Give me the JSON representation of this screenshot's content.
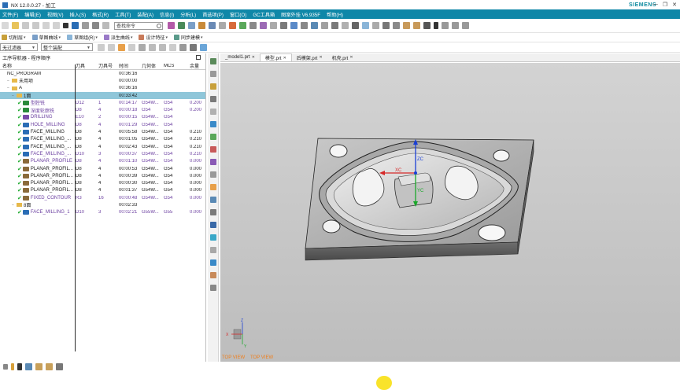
{
  "window": {
    "title": "NX 12.0.0.27 - 加工",
    "brand": "SIEMENS",
    "controls": [
      "—",
      "❐",
      "✕"
    ]
  },
  "menu": [
    "文件(F)",
    "编辑(E)",
    "视图(V)",
    "插入(S)",
    "格式(R)",
    "工具(T)",
    "装配(A)",
    "信息(I)",
    "分析(L)",
    "首选项(P)",
    "窗口(O)",
    "GC工具箱",
    "图案外挂 V6.935F",
    "帮助(H)"
  ],
  "toolbar": {
    "search_placeholder": "查找命令"
  },
  "toolbar2": {
    "items": [
      "切削层",
      "草图曲线",
      "草图组(R)",
      "派生曲线",
      "设计特征",
      "同步建模"
    ]
  },
  "filters": {
    "selection_filter": "无过滤器",
    "scope": "整个装配"
  },
  "navigator": {
    "title": "工序导航器 - 程序顺序",
    "columns": [
      "名称",
      "刀具",
      "刀具号",
      "时间",
      "几何体",
      "MCS",
      "余量"
    ],
    "tree": [
      {
        "name": "NC_PROGRAM",
        "time": "00:36:16",
        "level": 0
      },
      {
        "name": "未用项",
        "time": "00:00:00",
        "level": 1
      },
      {
        "name": "A",
        "time": "00:36:16",
        "level": 1
      },
      {
        "name": "1面",
        "time": "00:33:42",
        "level": 2,
        "selected": true
      }
    ],
    "operations": [
      {
        "name": "型腔铣",
        "tool": "D12",
        "num": "1",
        "time": "00:14:17",
        "geom": "G54W...",
        "mcs": "G54",
        "stock": "0.200",
        "purple": true,
        "icon": "#2a8a3a"
      },
      {
        "name": "深度轮廓铣",
        "tool": "D8",
        "num": "4",
        "time": "00:00:18",
        "geom": "G54",
        "mcs": "G54",
        "stock": "0.200",
        "purple": true,
        "icon": "#2a8a3a"
      },
      {
        "name": "DRILLING",
        "tool": "E10",
        "num": "2",
        "time": "00:00:15",
        "geom": "G54W...",
        "mcs": "G54",
        "stock": "",
        "purple": true,
        "icon": "#7a4aa8"
      },
      {
        "name": "HOLE_MILLING",
        "tool": "D8",
        "num": "4",
        "time": "00:01:29",
        "geom": "G54W...",
        "mcs": "G54",
        "stock": "",
        "purple": true,
        "icon": "#2a6db5"
      },
      {
        "name": "FACE_MILLING",
        "tool": "D8",
        "num": "4",
        "time": "00:05:58",
        "geom": "G54W...",
        "mcs": "G54",
        "stock": "0.210",
        "purple": false,
        "icon": "#2a6db5"
      },
      {
        "name": "FACE_MILLING_...",
        "tool": "D8",
        "num": "4",
        "time": "00:01:05",
        "geom": "G54W...",
        "mcs": "G54",
        "stock": "0.210",
        "purple": false,
        "icon": "#2a6db5"
      },
      {
        "name": "FACE_MILLING_...",
        "tool": "D8",
        "num": "4",
        "time": "00:02:43",
        "geom": "G54W...",
        "mcs": "G54",
        "stock": "0.210",
        "purple": false,
        "icon": "#2a6db5"
      },
      {
        "name": "FACE_MILLING_...",
        "tool": "D10",
        "num": "3",
        "time": "00:00:37",
        "geom": "G54W...",
        "mcs": "G54",
        "stock": "0.210",
        "purple": true,
        "icon": "#2a6db5"
      },
      {
        "name": "PLANAR_PROFILE",
        "tool": "D8",
        "num": "4",
        "time": "00:01:10",
        "geom": "G54W...",
        "mcs": "G54",
        "stock": "0.000",
        "purple": true,
        "icon": "#8a6a3a"
      },
      {
        "name": "PLANAR_PROFIL...",
        "tool": "D8",
        "num": "4",
        "time": "00:00:53",
        "geom": "G54W...",
        "mcs": "G54",
        "stock": "0.000",
        "purple": false,
        "icon": "#8a6a3a"
      },
      {
        "name": "PLANAR_PROFIL...",
        "tool": "D8",
        "num": "4",
        "time": "00:00:39",
        "geom": "G54W...",
        "mcs": "G54",
        "stock": "0.000",
        "purple": false,
        "icon": "#8a6a3a"
      },
      {
        "name": "PLANAR_PROFIL...",
        "tool": "D8",
        "num": "4",
        "time": "00:00:30",
        "geom": "G54W...",
        "mcs": "G54",
        "stock": "0.000",
        "purple": false,
        "icon": "#8a6a3a"
      },
      {
        "name": "PLANAR_PROFIL...",
        "tool": "D8",
        "num": "4",
        "time": "00:01:37",
        "geom": "G54W...",
        "mcs": "G54",
        "stock": "0.000",
        "purple": false,
        "icon": "#8a6a3a"
      },
      {
        "name": "FIXED_CONTOUR",
        "tool": "R3",
        "num": "16",
        "time": "00:00:48",
        "geom": "G54W...",
        "mcs": "G54",
        "stock": "0.000",
        "purple": true,
        "icon": "#8a6a3a"
      }
    ],
    "program2": {
      "name": "8面",
      "time": "00:02:33"
    },
    "program2_ops": [
      {
        "name": "FACE_MILLING_1",
        "tool": "D10",
        "num": "3",
        "time": "00:02:21",
        "geom": "G55W...",
        "mcs": "G55",
        "stock": "0.000",
        "purple": true,
        "icon": "#2a6db5"
      }
    ]
  },
  "tabs": [
    {
      "label": "_model1.prt",
      "active": false
    },
    {
      "label": "模型.prt",
      "active": true
    },
    {
      "label": "后模架.prt",
      "active": false
    },
    {
      "label": "机壳.prt",
      "active": false
    }
  ],
  "viewport": {
    "view_labels": [
      "TOP VIEW",
      "TOP VIEW"
    ],
    "triad_labels": [
      "XC",
      "YC",
      "ZC"
    ],
    "mini_triad_labels": [
      "Z",
      "X",
      "Y"
    ]
  },
  "colors": {
    "menu_bg": "#0f87a8",
    "selected_row": "#8fc6d9",
    "purple_text": "#6b3fa0",
    "view_label": "#f07e1b"
  }
}
